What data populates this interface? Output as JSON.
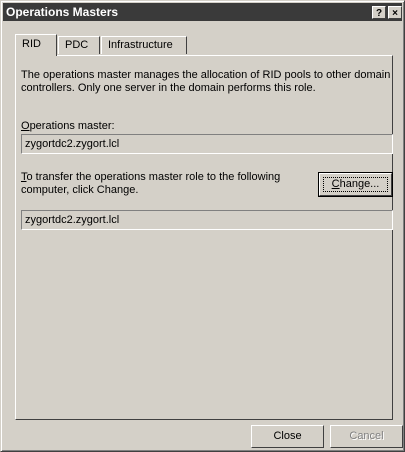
{
  "window": {
    "title": "Operations Masters",
    "help_glyph": "?",
    "close_glyph": "×"
  },
  "tabs": [
    {
      "label": "RID",
      "active": true
    },
    {
      "label": "PDC",
      "active": false
    },
    {
      "label": "Infrastructure",
      "active": false
    }
  ],
  "rid": {
    "description": "The operations master manages the allocation of RID pools to other domain controllers. Only one server in the domain performs this role.",
    "ops_master_label_accel": "O",
    "ops_master_label_rest": "perations master:",
    "ops_master_value": "zygortdc2.zygort.lcl",
    "transfer_label_accel": "T",
    "transfer_label_rest": "o transfer the operations master role to the following computer, click Change.",
    "change_button_accel": "C",
    "change_button_rest": "hange...",
    "target_value": "zygortdc2.zygort.lcl"
  },
  "footer": {
    "close_label": "Close",
    "cancel_label": "Cancel"
  }
}
